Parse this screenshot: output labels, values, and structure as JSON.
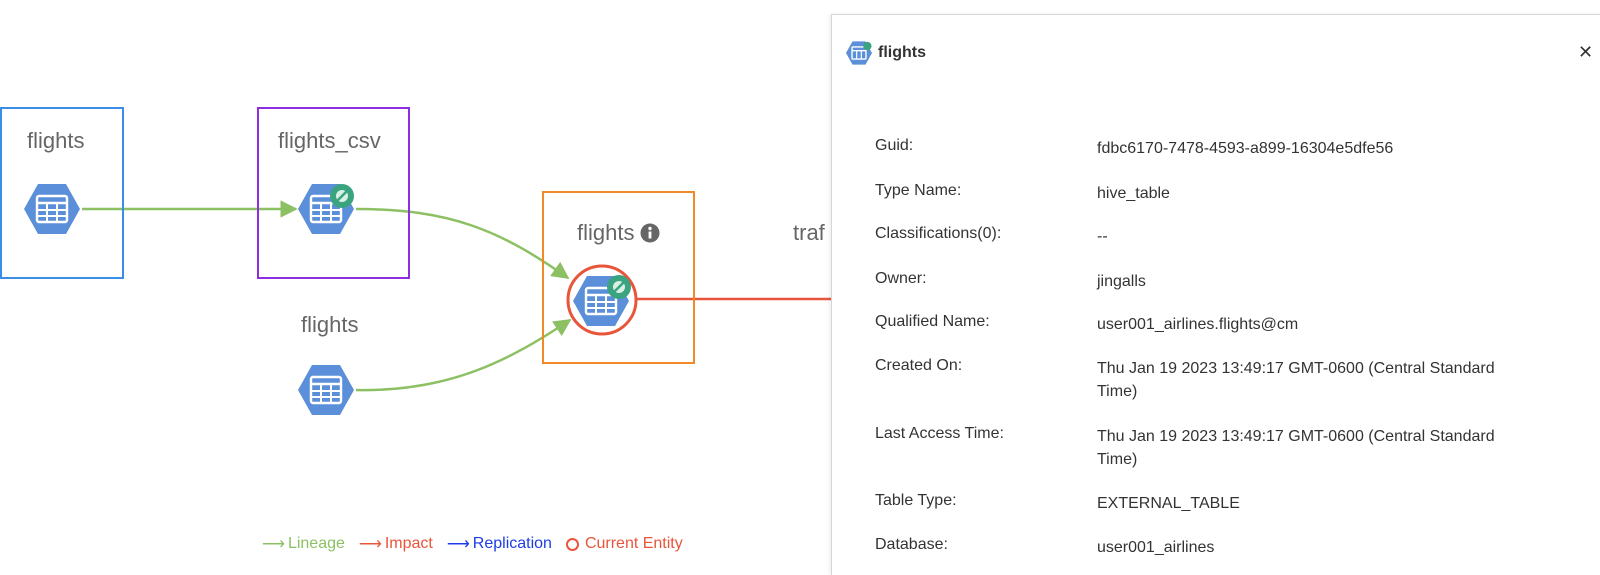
{
  "graph": {
    "nodes": [
      {
        "id": "n1",
        "label": "flights",
        "box_color": "#3b8ee8",
        "info_icon": false,
        "badge": false,
        "current": false
      },
      {
        "id": "n2",
        "label": "flights_csv",
        "box_color": "#8e2ee0",
        "info_icon": false,
        "badge": true,
        "current": false
      },
      {
        "id": "n3",
        "label": "flights",
        "box_color": "",
        "info_icon": false,
        "badge": false,
        "current": false
      },
      {
        "id": "n4",
        "label": "flights",
        "box_color": "#f08a24",
        "info_icon": true,
        "badge": true,
        "current": true
      },
      {
        "id": "n5",
        "label": "traf",
        "box_color": "",
        "info_icon": false,
        "badge": false,
        "current": false
      }
    ],
    "edges": [
      {
        "from": "n1",
        "to": "n2",
        "kind": "lineage"
      },
      {
        "from": "n2",
        "to": "n4",
        "kind": "lineage"
      },
      {
        "from": "n3",
        "to": "n4",
        "kind": "lineage"
      },
      {
        "from": "n4",
        "to": "n5",
        "kind": "impact"
      }
    ],
    "colors": {
      "lineage": "#8cc063",
      "impact": "#e9553a",
      "replication": "#1d3ce4",
      "node_fill": "#5b8fd9"
    },
    "icons": {
      "table": "table-hexagon-icon",
      "badge": "classification-badge-icon",
      "info": "info-circle-icon"
    }
  },
  "legend": {
    "lineage": "Lineage",
    "impact": "Impact",
    "replication": "Replication",
    "current": "Current Entity"
  },
  "panel": {
    "title": "flights",
    "close_icon": "close-icon",
    "rows": [
      {
        "label": "Guid:",
        "value": "fdbc6170-7478-4593-a899-16304e5dfe56"
      },
      {
        "label": "Type Name:",
        "value": "hive_table"
      },
      {
        "label": "Classifications(0):",
        "value": "--"
      },
      {
        "label": "Owner:",
        "value": "jingalls"
      },
      {
        "label": "Qualified Name:",
        "value": "user001_airlines.flights@cm"
      },
      {
        "label": "Created On:",
        "value": "Thu Jan 19 2023 13:49:17 GMT-0600 (Central Standard Time)"
      },
      {
        "label": "Last Access Time:",
        "value": "Thu Jan 19 2023 13:49:17 GMT-0600 (Central Standard Time)"
      },
      {
        "label": "Table Type:",
        "value": "EXTERNAL_TABLE"
      },
      {
        "label": "Database:",
        "value": "user001_airlines"
      }
    ]
  }
}
